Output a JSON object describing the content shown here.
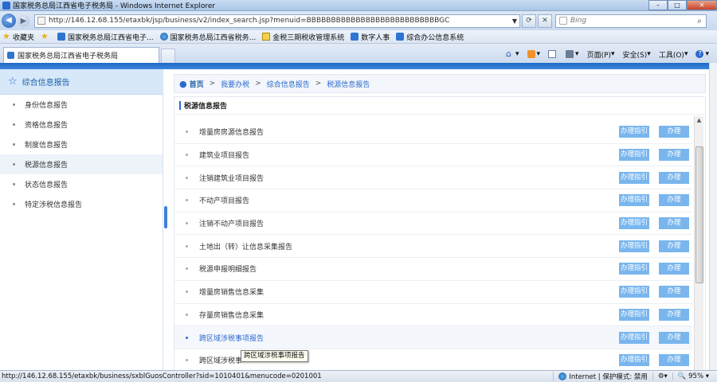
{
  "window": {
    "title": "国家税务总局江西省电子税务局 - Windows Internet Explorer",
    "minimize": "–",
    "maximize": "□",
    "close": "✕"
  },
  "address": {
    "url": "http://146.12.68.155/etaxbk/jsp/business/v2/index_search.jsp?menuid=BBBBBBBBBBBBBBBBBBBBBBBBBBBGC",
    "search_placeholder": "Bing"
  },
  "favorites": {
    "label": "收藏夹",
    "items": [
      "国家税务总局江西省电子...",
      "国家税务总局江西省税务...",
      "金税三期税收管理系统",
      "数字人事",
      "综合办公信息系统"
    ]
  },
  "tab": {
    "label": "国家税务总局江西省电子税务局"
  },
  "command_bar": {
    "page": "页面(P)",
    "safety": "安全(S)",
    "tools": "工具(O)"
  },
  "sidebar": {
    "header": "综合信息报告",
    "items": [
      "身份信息报告",
      "资格信息报告",
      "制度信息报告",
      "税源信息报告",
      "状态信息报告",
      "特定涉税信息报告"
    ],
    "active_index": 3
  },
  "breadcrumb": {
    "home": "首页",
    "level1": "我要办税",
    "level2": "综合信息报告",
    "level3": "税源信息报告",
    "sep": ">"
  },
  "section": {
    "title": "税源信息报告",
    "guide_label": "办理指引",
    "do_label": "办理",
    "rows": [
      "增量房房源信息报告",
      "建筑业项目报告",
      "注销建筑业项目报告",
      "不动产项目报告",
      "注销不动产项目报告",
      "土地出（转）让信息采集报告",
      "税源申报明细报告",
      "增量房销售信息采集",
      "存量房销售信息采集",
      "跨区域涉税事项报告",
      "跨区域涉税事"
    ],
    "hover_index": 9
  },
  "tooltip": "跨区域涉税事项报告",
  "statusbar": {
    "url": "http://146.12.68.155/etaxbk/business/sxblGuosController?sid=1010401&menucode=0201001",
    "zone": "Internet | 保护模式: 禁用",
    "zoom": "95%"
  }
}
